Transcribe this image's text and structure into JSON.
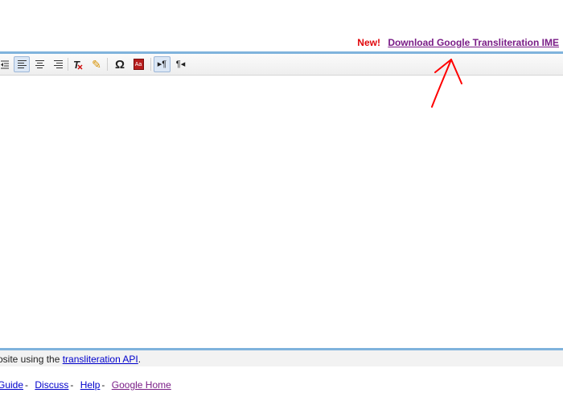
{
  "promo": {
    "new_label": "New!",
    "download_link": "Download Google Transliteration IME"
  },
  "toolbar": {
    "icons": [
      "outdent-icon",
      "align-left-icon",
      "align-center-icon",
      "align-right-icon",
      "remove-format-icon",
      "pencil-icon",
      "omega-icon",
      "dictionary-icon",
      "ltr-pilcrow-icon",
      "rtl-pilcrow-icon"
    ],
    "symbols": {
      "remove_format": "T",
      "pencil": "✎",
      "omega": "Ω",
      "dictionary": "Aa",
      "ltr": "▸¶",
      "rtl": "¶◂"
    }
  },
  "status": {
    "prefix": "osite using the ",
    "link": "transliteration API",
    "suffix": "."
  },
  "footer": {
    "links": [
      {
        "label": "Guide",
        "sep": "-"
      },
      {
        "label": "Discuss",
        "sep": "-"
      },
      {
        "label": "Help",
        "sep": "-"
      },
      {
        "label": "Google Home",
        "sep": ""
      }
    ]
  },
  "colors": {
    "accent_border": "#7fb3dc",
    "new_label": "#e1060b",
    "visited_link": "#7a1d87",
    "link": "#0000cc",
    "annotation": "#ff0000"
  }
}
